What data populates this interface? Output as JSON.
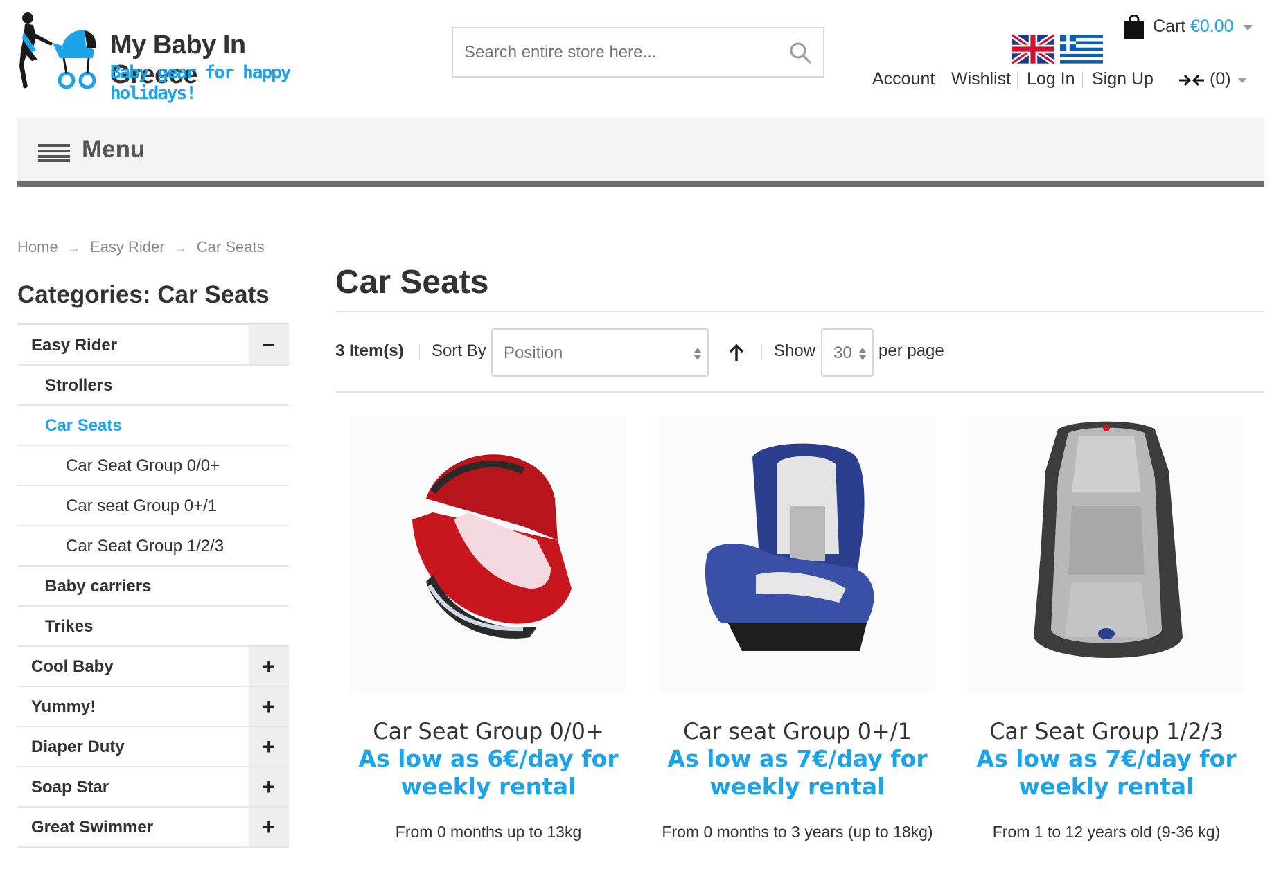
{
  "brand": {
    "name": "My Baby In Greece",
    "tagline": "Baby gear for happy holidays!"
  },
  "search": {
    "placeholder": "Search entire store here..."
  },
  "languages": [
    "English",
    "Greek"
  ],
  "cart": {
    "label": "Cart",
    "amount": "€0.00"
  },
  "top_links": {
    "account": "Account",
    "wishlist": "Wishlist",
    "login": "Log In",
    "signup": "Sign Up",
    "compare_count": "(0)"
  },
  "menu": {
    "label": "Menu"
  },
  "breadcrumb": [
    "Home",
    "Easy Rider",
    "Car Seats"
  ],
  "sidebar": {
    "title": "Categories: Car Seats",
    "items": [
      {
        "label": "Easy Rider",
        "level": 1,
        "toggle": "−"
      },
      {
        "label": "Strollers",
        "level": 2
      },
      {
        "label": "Car Seats",
        "level": 2,
        "active": true
      },
      {
        "label": "Car Seat Group 0/0+",
        "level": 3
      },
      {
        "label": "Car seat Group 0+/1",
        "level": 3
      },
      {
        "label": "Car Seat Group 1/2/3",
        "level": 3
      },
      {
        "label": "Baby carriers",
        "level": 2
      },
      {
        "label": "Trikes",
        "level": 2
      },
      {
        "label": "Cool Baby",
        "level": 1,
        "toggle": "+"
      },
      {
        "label": "Yummy!",
        "level": 1,
        "toggle": "+"
      },
      {
        "label": "Diaper Duty",
        "level": 1,
        "toggle": "+"
      },
      {
        "label": "Soap Star",
        "level": 1,
        "toggle": "+"
      },
      {
        "label": "Great Swimmer",
        "level": 1,
        "toggle": "+"
      }
    ]
  },
  "main": {
    "title": "Car Seats",
    "toolbar": {
      "count": "3 Item(s)",
      "sort_by_label": "Sort By",
      "sort_value": "Position",
      "show_label": "Show",
      "show_value": "30",
      "per_page_label": "per page"
    },
    "products": [
      {
        "name": "Car Seat Group 0/0+",
        "price": "As low as 6€/day for weekly rental",
        "desc": "From 0 months up to 13kg"
      },
      {
        "name": "Car seat Group 0+/1",
        "price": "As low as 7€/day for weekly rental",
        "desc": "From 0 months to 3 years (up to 18kg)"
      },
      {
        "name": "Car Seat Group 1/2/3",
        "price": "As low as 7€/day for weekly rental",
        "desc": "From 1 to 12 years old (9-36 kg)"
      }
    ]
  },
  "colors": {
    "accent": "#1ca4e8",
    "menu_bar": "#f4f4f4",
    "menu_border": "#6e6e6e"
  }
}
